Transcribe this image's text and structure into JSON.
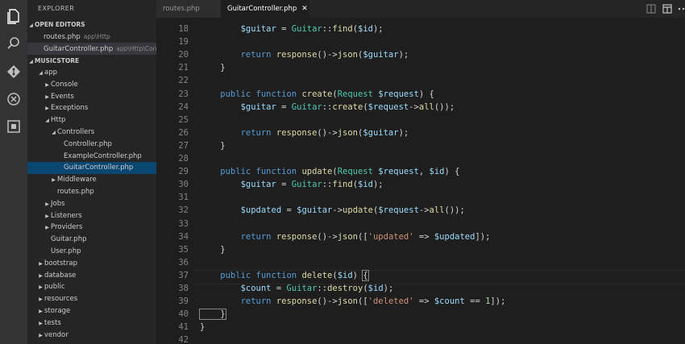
{
  "explorer": {
    "title": "EXPLORER",
    "open_editors_label": "OPEN EDITORS",
    "project_label": "MUSICSTORE",
    "open_editors": [
      {
        "name": "routes.php",
        "desc": "app\\Http"
      },
      {
        "name": "GuitarController.php",
        "desc": "app\\Http\\Con..."
      }
    ],
    "tree": [
      {
        "label": "app",
        "expanded": true
      },
      {
        "label": "Console",
        "expanded": false
      },
      {
        "label": "Events",
        "expanded": false
      },
      {
        "label": "Exceptions",
        "expanded": false
      },
      {
        "label": "Http",
        "expanded": true
      },
      {
        "label": "Controllers",
        "expanded": true
      },
      {
        "label": "Controller.php"
      },
      {
        "label": "ExampleController.php"
      },
      {
        "label": "GuitarController.php"
      },
      {
        "label": "Middleware",
        "expanded": false
      },
      {
        "label": "routes.php"
      },
      {
        "label": "Jobs",
        "expanded": false
      },
      {
        "label": "Listeners",
        "expanded": false
      },
      {
        "label": "Providers",
        "expanded": false
      },
      {
        "label": "Guitar.php"
      },
      {
        "label": "User.php"
      },
      {
        "label": "bootstrap",
        "expanded": false
      },
      {
        "label": "database",
        "expanded": false
      },
      {
        "label": "public",
        "expanded": false
      },
      {
        "label": "resources",
        "expanded": false
      },
      {
        "label": "storage",
        "expanded": false
      },
      {
        "label": "tests",
        "expanded": false
      },
      {
        "label": "vendor",
        "expanded": false
      }
    ]
  },
  "tabs": [
    {
      "label": "routes.php",
      "active": false
    },
    {
      "label": "GuitarController.php",
      "active": true,
      "close": "✕"
    }
  ],
  "editor": {
    "first_line": 18,
    "lines": [
      [
        [
          "var",
          "        $guitar"
        ],
        [
          "txt",
          " = "
        ],
        [
          "cls",
          "Guitar"
        ],
        [
          "txt",
          "::"
        ],
        [
          "fn",
          "find"
        ],
        [
          "txt",
          "("
        ],
        [
          "var",
          "$id"
        ],
        [
          "txt",
          ");"
        ]
      ],
      [],
      [
        [
          "kw",
          "        return "
        ],
        [
          "fn",
          "response"
        ],
        [
          "txt",
          "()->"
        ],
        [
          "fn",
          "json"
        ],
        [
          "txt",
          "("
        ],
        [
          "var",
          "$guitar"
        ],
        [
          "txt",
          ");"
        ]
      ],
      [
        [
          "txt",
          "    }"
        ]
      ],
      [],
      [
        [
          "kw",
          "    public function "
        ],
        [
          "fn",
          "create"
        ],
        [
          "txt",
          "("
        ],
        [
          "cls",
          "Request"
        ],
        [
          "txt",
          " "
        ],
        [
          "var",
          "$request"
        ],
        [
          "txt",
          ") {"
        ]
      ],
      [
        [
          "var",
          "        $guitar"
        ],
        [
          "txt",
          " = "
        ],
        [
          "cls",
          "Guitar"
        ],
        [
          "txt",
          "::"
        ],
        [
          "fn",
          "create"
        ],
        [
          "txt",
          "("
        ],
        [
          "var",
          "$request"
        ],
        [
          "txt",
          "->"
        ],
        [
          "fn",
          "all"
        ],
        [
          "txt",
          "());"
        ]
      ],
      [],
      [
        [
          "kw",
          "        return "
        ],
        [
          "fn",
          "response"
        ],
        [
          "txt",
          "()->"
        ],
        [
          "fn",
          "json"
        ],
        [
          "txt",
          "("
        ],
        [
          "var",
          "$guitar"
        ],
        [
          "txt",
          ");"
        ]
      ],
      [
        [
          "txt",
          "    }"
        ]
      ],
      [],
      [
        [
          "kw",
          "    public function "
        ],
        [
          "fn",
          "update"
        ],
        [
          "txt",
          "("
        ],
        [
          "cls",
          "Request"
        ],
        [
          "txt",
          " "
        ],
        [
          "var",
          "$request"
        ],
        [
          "txt",
          ", "
        ],
        [
          "var",
          "$id"
        ],
        [
          "txt",
          ") {"
        ]
      ],
      [
        [
          "var",
          "        $guitar"
        ],
        [
          "txt",
          " = "
        ],
        [
          "cls",
          "Guitar"
        ],
        [
          "txt",
          "::"
        ],
        [
          "fn",
          "find"
        ],
        [
          "txt",
          "("
        ],
        [
          "var",
          "$id"
        ],
        [
          "txt",
          ");"
        ]
      ],
      [],
      [
        [
          "var",
          "        $updated"
        ],
        [
          "txt",
          " = "
        ],
        [
          "var",
          "$guitar"
        ],
        [
          "txt",
          "->"
        ],
        [
          "fn",
          "update"
        ],
        [
          "txt",
          "("
        ],
        [
          "var",
          "$request"
        ],
        [
          "txt",
          "->"
        ],
        [
          "fn",
          "all"
        ],
        [
          "txt",
          "());"
        ]
      ],
      [],
      [
        [
          "kw",
          "        return "
        ],
        [
          "fn",
          "response"
        ],
        [
          "txt",
          "()->"
        ],
        [
          "fn",
          "json"
        ],
        [
          "txt",
          "(["
        ],
        [
          "str",
          "'updated'"
        ],
        [
          "txt",
          " => "
        ],
        [
          "var",
          "$updated"
        ],
        [
          "txt",
          "]);"
        ]
      ],
      [
        [
          "txt",
          "    }"
        ]
      ],
      [],
      [
        [
          "kw",
          "    public function "
        ],
        [
          "fn",
          "delete"
        ],
        [
          "txt",
          "("
        ],
        [
          "var",
          "$id"
        ],
        [
          "txt",
          ") "
        ],
        [
          "bracket",
          "{"
        ]
      ],
      [
        [
          "var",
          "        $count"
        ],
        [
          "txt",
          " = "
        ],
        [
          "cls",
          "Guitar"
        ],
        [
          "txt",
          "::"
        ],
        [
          "fn",
          "destroy"
        ],
        [
          "txt",
          "("
        ],
        [
          "var",
          "$id"
        ],
        [
          "txt",
          ");"
        ]
      ],
      [
        [
          "kw",
          "        return "
        ],
        [
          "fn",
          "response"
        ],
        [
          "txt",
          "()->"
        ],
        [
          "fn",
          "json"
        ],
        [
          "txt",
          "(["
        ],
        [
          "str",
          "'deleted'"
        ],
        [
          "txt",
          " => "
        ],
        [
          "var",
          "$count"
        ],
        [
          "txt",
          " == "
        ],
        [
          "num",
          "1"
        ],
        [
          "txt",
          "]);"
        ]
      ],
      [
        [
          "bracket",
          "    }"
        ]
      ],
      [
        [
          "txt",
          "}"
        ]
      ],
      []
    ]
  },
  "colors": {
    "activity_bar": "#333333",
    "sidebar": "#252526",
    "editor": "#1e1e1e",
    "selection": "#094771"
  },
  "icons": [
    "files-icon",
    "search-icon",
    "git-icon",
    "debug-icon",
    "extensions-icon",
    "split-editor-icon",
    "layout-icon",
    "more-icon"
  ]
}
